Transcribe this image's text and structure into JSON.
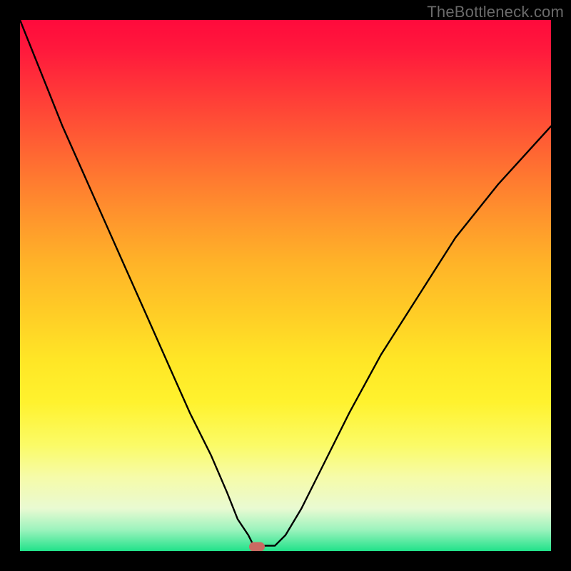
{
  "attribution": "TheBottleneck.com",
  "colors": {
    "frame": "#000000",
    "gradient_top": "#ff0a3c",
    "gradient_mid": "#ffe022",
    "gradient_bottom": "#21e28a",
    "curve": "#000000",
    "marker": "#c96a62",
    "attrib_text": "#6a6a6a"
  },
  "marker": {
    "x_pct": 44.6,
    "y_pct": 99.2
  },
  "chart_data": {
    "type": "line",
    "title": "",
    "xlabel": "",
    "ylabel": "",
    "xlim": [
      0,
      100
    ],
    "ylim": [
      0,
      100
    ],
    "grid": false,
    "legend": false,
    "note": "axes are normalized 0-100 (no tick labels visible)",
    "series": [
      {
        "name": "curve",
        "x": [
          0,
          4,
          8,
          12,
          16,
          20,
          24,
          28,
          32,
          36,
          39,
          41,
          43,
          44,
          46,
          48,
          50,
          53,
          57,
          62,
          68,
          75,
          82,
          90,
          100
        ],
        "y": [
          100,
          90,
          80,
          71,
          62,
          53,
          44,
          35,
          26,
          18,
          11,
          6,
          3,
          1,
          1,
          1,
          3,
          8,
          16,
          26,
          37,
          48,
          59,
          69,
          80
        ]
      }
    ],
    "minimum_at": {
      "x": 45,
      "y": 1
    }
  }
}
